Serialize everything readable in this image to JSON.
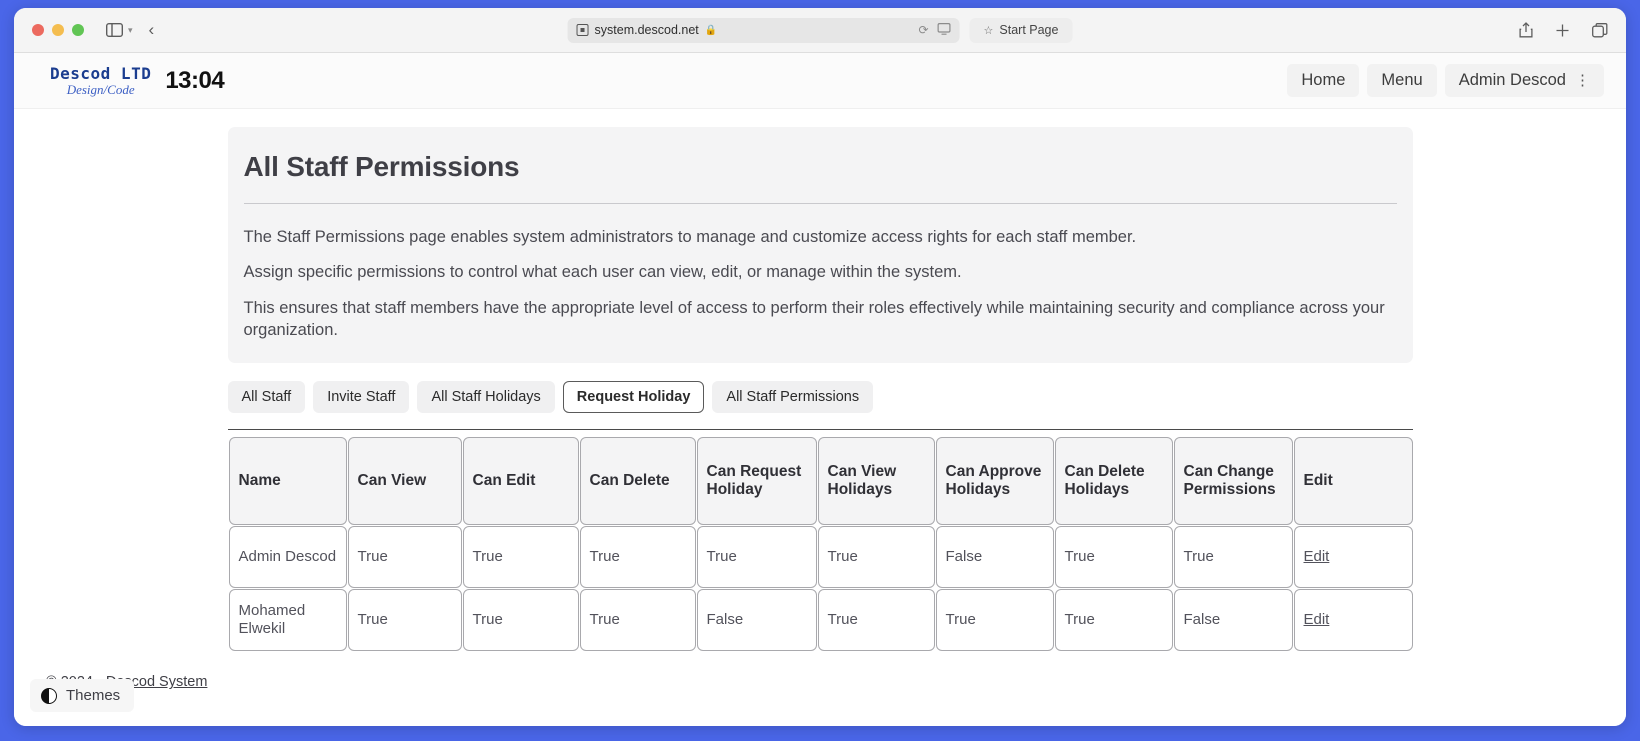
{
  "browser": {
    "traffic_lights": [
      "close",
      "minimize",
      "zoom"
    ],
    "sidebar_toggle_icon": "sidebar-icon",
    "sidebar_chevron_icon": "chevron-down-icon",
    "back_icon": "chevron-left-icon",
    "url": "system.descod.net",
    "url_page_icon": "page-icon",
    "lock_icon": "lock-icon",
    "reload_icon": "reload-icon",
    "cast_icon": "screen-share-icon",
    "start_page_label": "Start Page",
    "star_icon": "star-icon",
    "share_icon": "share-icon",
    "new_tab_icon": "plus-icon",
    "tab_overview_icon": "tab-overview-icon"
  },
  "site_header": {
    "logo_main": "Descod LTD",
    "logo_sub": "Design/Code",
    "clock": "13:04",
    "nav": [
      {
        "label": "Home"
      },
      {
        "label": "Menu"
      },
      {
        "label": "Admin Descod",
        "kebab": "⋮"
      }
    ]
  },
  "page": {
    "title": "All Staff Permissions",
    "paragraphs": [
      "The Staff Permissions page enables system administrators to manage and customize access rights for each staff member.",
      "Assign specific permissions to control what each user can view, edit, or manage within the system.",
      "This ensures that staff members have the appropriate level of access to perform their roles effectively while maintaining security and compliance across your organization."
    ],
    "tabs": [
      {
        "label": "All Staff",
        "active": false
      },
      {
        "label": "Invite Staff",
        "active": false
      },
      {
        "label": "All Staff Holidays",
        "active": false
      },
      {
        "label": "Request Holiday",
        "active": true
      },
      {
        "label": "All Staff Permissions",
        "active": false
      }
    ]
  },
  "table": {
    "headers": [
      "Name",
      "Can View",
      "Can Edit",
      "Can Delete",
      "Can Request Holiday",
      "Can View Holidays",
      "Can Approve Holidays",
      "Can Delete Holidays",
      "Can Change Permissions",
      "Edit"
    ],
    "rows": [
      {
        "name": "Admin Descod",
        "can_view": "True",
        "can_edit": "True",
        "can_delete": "True",
        "can_request_holiday": "True",
        "can_view_holidays": "True",
        "can_approve_holidays": "False",
        "can_delete_holidays": "True",
        "can_change_permissions": "True",
        "action": "Edit"
      },
      {
        "name": "Mohamed Elwekil",
        "can_view": "True",
        "can_edit": "True",
        "can_delete": "True",
        "can_request_holiday": "False",
        "can_view_holidays": "True",
        "can_approve_holidays": "True",
        "can_delete_holidays": "True",
        "can_change_permissions": "False",
        "action": "Edit"
      }
    ]
  },
  "footer": {
    "copyright": "© 2024 - ",
    "link": "Descod System"
  },
  "themes": {
    "label": "Themes",
    "icon": "contrast-icon"
  },
  "colors": {
    "desktop": "#4a66e8",
    "card_bg": "#f4f4f5",
    "brand": "#1b3d8f",
    "text": "#3f3f46"
  }
}
